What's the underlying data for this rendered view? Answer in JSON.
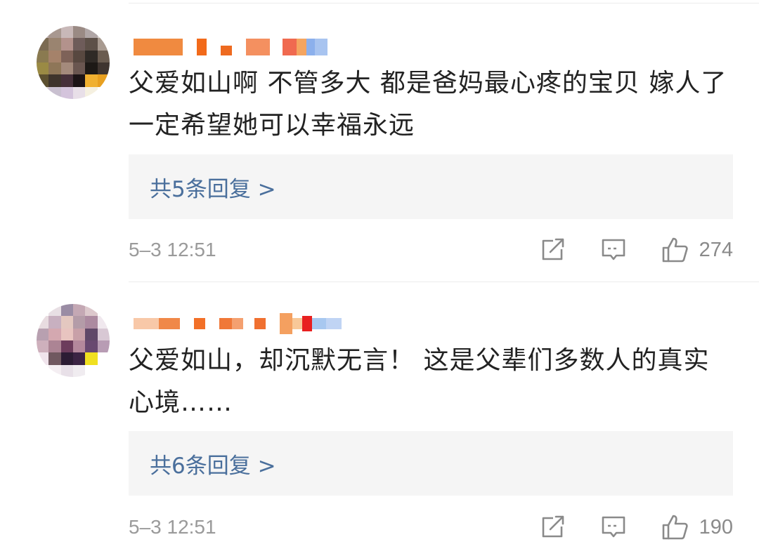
{
  "comments": [
    {
      "username": "",
      "text": "父爱如山啊 不管多大 都是爸妈最心疼的宝贝 嫁人了 一定希望她可以幸福永远",
      "replies": "共5条回复 >",
      "timestamp": "5–3 12:51",
      "likes": "274",
      "icons": [
        "share-icon",
        "comment-icon",
        "like-icon"
      ]
    },
    {
      "username": "",
      "text": "父爱如山，却沉默无言！ 这是父辈们多数人的真实心境……",
      "replies": "共6条回复 >",
      "timestamp": "5–3 12:51",
      "likes": "190",
      "icons": [
        "share-icon",
        "comment-icon",
        "like-icon"
      ]
    }
  ],
  "colors": {
    "reply_link": "#4a6f9c",
    "reply_background": "#f5f5f5",
    "meta_text": "#9a9a9a"
  }
}
